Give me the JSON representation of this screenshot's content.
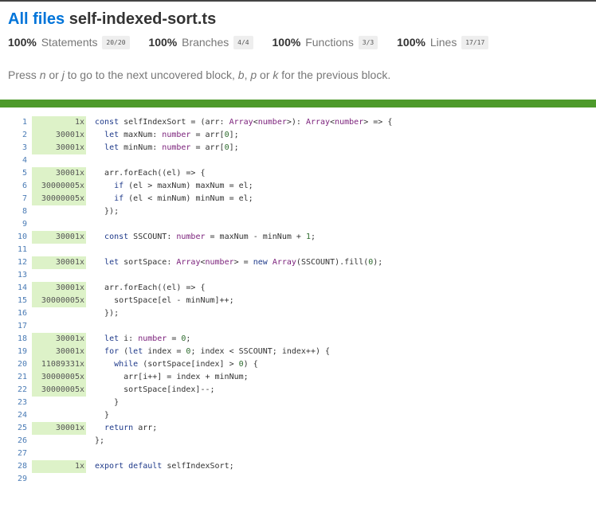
{
  "header": {
    "all_files_link": "All files",
    "file_name": "self-indexed-sort.ts"
  },
  "stats": [
    {
      "pct": "100%",
      "label": "Statements",
      "fraction": "20/20"
    },
    {
      "pct": "100%",
      "label": "Branches",
      "fraction": "4/4"
    },
    {
      "pct": "100%",
      "label": "Functions",
      "fraction": "3/3"
    },
    {
      "pct": "100%",
      "label": "Lines",
      "fraction": "17/17"
    }
  ],
  "hint": {
    "prefix": "Press ",
    "key_n": "n",
    "or1": " or ",
    "key_j": "j",
    "middle": " to go to the next uncovered block, ",
    "key_b": "b",
    "comma": ", ",
    "key_p": "p",
    "or2": " or ",
    "key_k": "k",
    "suffix": " for the previous block."
  },
  "colors": {
    "link": "#0074D9",
    "coverage_bar": "#4d9a2b",
    "covered_count_bg": "#ddf2c8",
    "empty_count_bg": "#eaeaea"
  },
  "code_lines": [
    {
      "n": "1",
      "count": "1x",
      "code": "const selfIndexSort = (arr: Array<number>): Array<number> => {"
    },
    {
      "n": "2",
      "count": "30001x",
      "code": "  let maxNum: number = arr[0];"
    },
    {
      "n": "3",
      "count": "30001x",
      "code": "  let minNum: number = arr[0];"
    },
    {
      "n": "4",
      "count": "",
      "code": ""
    },
    {
      "n": "5",
      "count": "30001x",
      "code": "  arr.forEach((el) => {"
    },
    {
      "n": "6",
      "count": "30000005x",
      "code": "    if (el > maxNum) maxNum = el;"
    },
    {
      "n": "7",
      "count": "30000005x",
      "code": "    if (el < minNum) minNum = el;"
    },
    {
      "n": "8",
      "count": "",
      "code": "  });"
    },
    {
      "n": "9",
      "count": "",
      "code": ""
    },
    {
      "n": "10",
      "count": "30001x",
      "code": "  const SSCOUNT: number = maxNum - minNum + 1;"
    },
    {
      "n": "11",
      "count": "",
      "code": ""
    },
    {
      "n": "12",
      "count": "30001x",
      "code": "  let sortSpace: Array<number> = new Array(SSCOUNT).fill(0);"
    },
    {
      "n": "13",
      "count": "",
      "code": ""
    },
    {
      "n": "14",
      "count": "30001x",
      "code": "  arr.forEach((el) => {"
    },
    {
      "n": "15",
      "count": "30000005x",
      "code": "    sortSpace[el - minNum]++;"
    },
    {
      "n": "16",
      "count": "",
      "code": "  });"
    },
    {
      "n": "17",
      "count": "",
      "code": ""
    },
    {
      "n": "18",
      "count": "30001x",
      "code": "  let i: number = 0;"
    },
    {
      "n": "19",
      "count": "30001x",
      "code": "  for (let index = 0; index < SSCOUNT; index++) {"
    },
    {
      "n": "20",
      "count": "11089331x",
      "code": "    while (sortSpace[index] > 0) {"
    },
    {
      "n": "21",
      "count": "30000005x",
      "code": "      arr[i++] = index + minNum;"
    },
    {
      "n": "22",
      "count": "30000005x",
      "code": "      sortSpace[index]--;"
    },
    {
      "n": "23",
      "count": "",
      "code": "    }"
    },
    {
      "n": "24",
      "count": "",
      "code": "  }"
    },
    {
      "n": "25",
      "count": "30001x",
      "code": "  return arr;"
    },
    {
      "n": "26",
      "count": "",
      "code": "};"
    },
    {
      "n": "27",
      "count": "",
      "code": ""
    },
    {
      "n": "28",
      "count": "1x",
      "code": "export default selfIndexSort;"
    },
    {
      "n": "29",
      "count": "",
      "code": ""
    }
  ]
}
